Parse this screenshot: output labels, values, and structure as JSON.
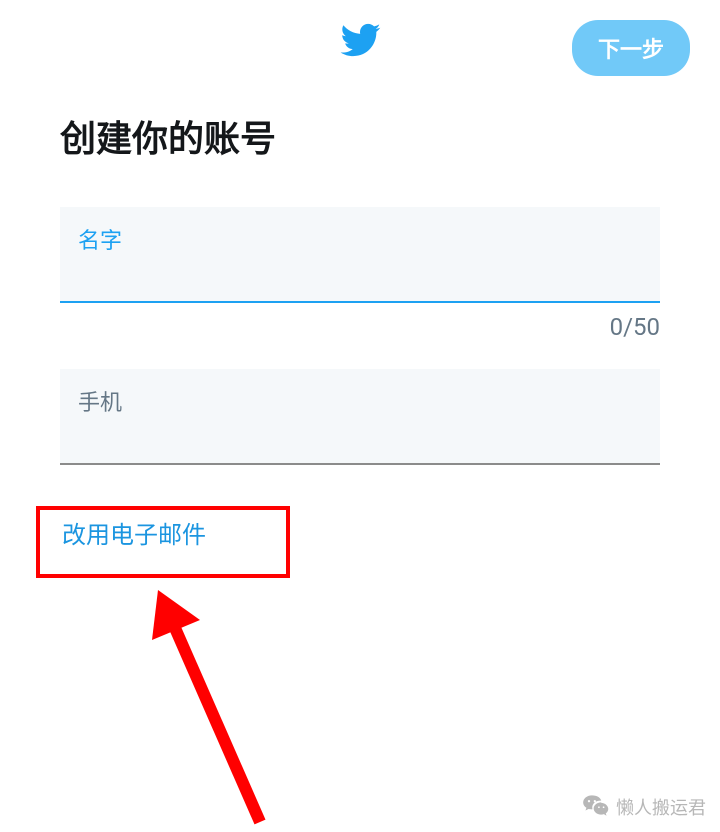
{
  "header": {
    "next_button_label": "下一步"
  },
  "page": {
    "title": "创建你的账号"
  },
  "form": {
    "name_label": "名字",
    "name_counter": "0/50",
    "phone_label": "手机",
    "use_email_label": "改用电子邮件"
  },
  "watermark": {
    "text": "懒人搬运君"
  }
}
